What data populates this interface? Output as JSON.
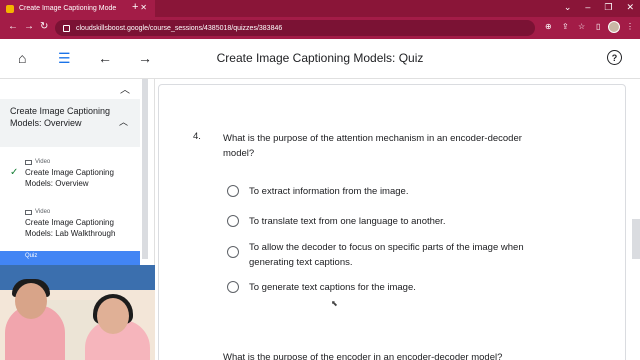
{
  "browser": {
    "tab_title": "Create Image Captioning Mode",
    "url": "cloudskillsboost.google/course_sessions/4385018/quizzes/383846"
  },
  "header": {
    "title": "Create Image Captioning Models: Quiz"
  },
  "sidebar": {
    "section_title": "Create Image Captioning Models: Overview",
    "items": [
      {
        "kind": "Video",
        "label": "Create Image Captioning Models: Overview",
        "completed": true
      },
      {
        "kind": "Video",
        "label": "Create Image Captioning Models: Lab Walkthrough",
        "completed": false
      }
    ],
    "current_kind": "Quiz"
  },
  "quiz": {
    "question_number": "4.",
    "question_text": "What is the purpose of the attention mechanism in an encoder-decoder model?",
    "options": [
      "To extract information from the image.",
      "To translate text from one language to another.",
      "To allow the decoder to focus on specific parts of the image when generating text captions.",
      "To generate text captions for the image."
    ],
    "next_question_partial": "What is the purpose of the encoder in an encoder-decoder model?"
  },
  "icons": {
    "home": "home-icon",
    "list": "list-icon",
    "back": "arrow-left-icon",
    "forward": "arrow-right-icon",
    "help": "help-icon"
  },
  "colors": {
    "browser_chrome": "#a31c47",
    "accent_blue": "#4285f4",
    "check_green": "#188038"
  }
}
